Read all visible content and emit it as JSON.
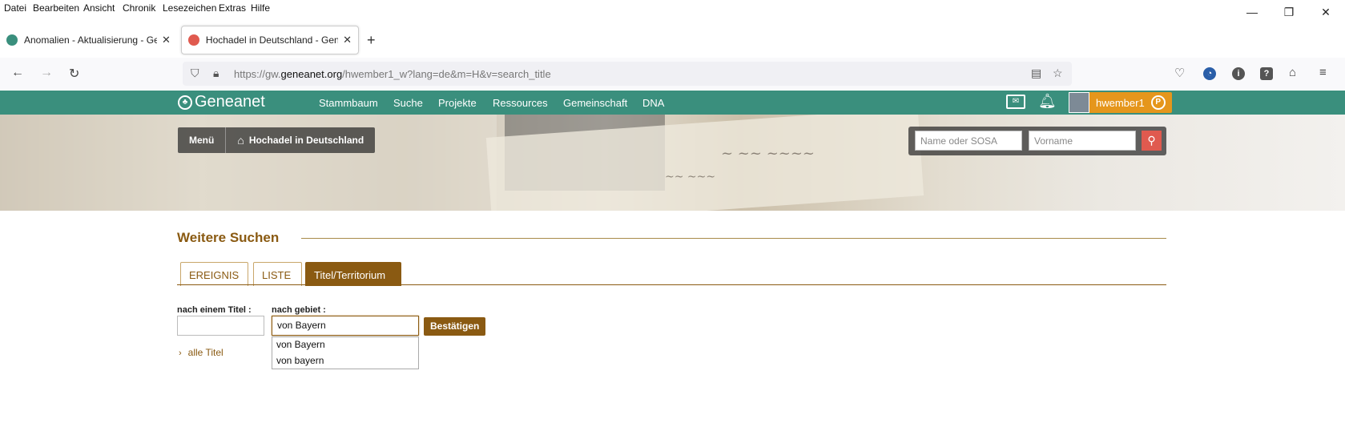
{
  "menubar": {
    "items": [
      {
        "label": "Datei"
      },
      {
        "label": "Bearbeiten"
      },
      {
        "label": "Ansicht"
      },
      {
        "label": "Chronik"
      },
      {
        "label": "Lesezeichen"
      },
      {
        "label": "Extras"
      },
      {
        "label": "Hilfe"
      }
    ]
  },
  "window": {
    "minimize": "—",
    "restore": "❐",
    "close": "✕"
  },
  "tabs": [
    {
      "label": "Anomalien - Aktualisierung - Ge",
      "close": "✕",
      "favicon_color": "#3a8f7d"
    },
    {
      "label": "Hochadel in Deutschland - Gen",
      "close": "✕",
      "favicon_color": "#e05a4f"
    }
  ],
  "newtab": "+",
  "url": {
    "prefix": "https://gw.",
    "host": "geneanet.org",
    "path": "/hwember1_w?lang=de&m=H&v=search_title"
  },
  "nav": {
    "back": "←",
    "forward": "→",
    "reload": "↻"
  },
  "header": {
    "logo": "Geneanet",
    "nav": [
      "Stammbaum",
      "Suche",
      "Projekte",
      "Ressources",
      "Gemeinschaft",
      "DNA"
    ],
    "username": "hwember1",
    "badge": "P",
    "brand_color": "#3a8f7d",
    "user_color": "#e5961c"
  },
  "banner": {
    "menu": "Menü",
    "tree_title": "Hochadel in Deutschland",
    "search_name_placeholder": "Name oder SOSA",
    "search_firstname_placeholder": "Vorname"
  },
  "content": {
    "title": "Weitere Suchen",
    "tabs": [
      "EREIGNIS",
      "LISTE",
      "Titel/Territorium"
    ],
    "label_title": "nach einem Titel :",
    "label_area": "nach gebiet :",
    "title_value": "",
    "area_value": "von Bayern",
    "confirm": "Bestätigen",
    "all_titles": "alle Titel",
    "suggestions": [
      "von Bayern",
      "von bayern"
    ],
    "accent_color": "#8a5a12"
  }
}
